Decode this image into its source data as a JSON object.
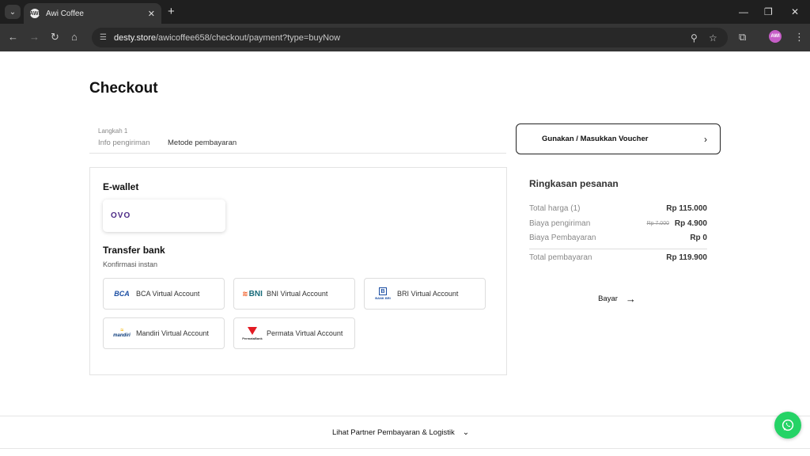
{
  "browser": {
    "tab_title": "Awi Coffee",
    "favicon_text": "AWI",
    "url_host": "desty.store",
    "url_path": "/awicoffee658/checkout/payment?type=buyNow",
    "profile_text": "AWI",
    "icons": [
      "search-tabs-icon",
      "close-icon",
      "plus-icon",
      "minimize-icon",
      "restore-icon",
      "close-window-icon",
      "back-icon",
      "forward-icon",
      "reload-icon",
      "home-icon",
      "site-info-icon",
      "zoom-icon",
      "star-icon",
      "extensions-icon",
      "menu-icon"
    ]
  },
  "page": {
    "title": "Checkout"
  },
  "steps": {
    "step_number": "Langkah 1",
    "step1_label": "Info pengiriman",
    "step2_label": "Metode pembayaran"
  },
  "voucher": {
    "label": "Gunakan / Masukkan Voucher"
  },
  "ewallet": {
    "title": "E-wallet",
    "items": [
      {
        "name": "ovo",
        "logo_text": "OVO"
      }
    ]
  },
  "bank": {
    "title": "Transfer bank",
    "subtitle": "Konfirmasi instan",
    "items": [
      {
        "label": "BCA Virtual Account",
        "logo_text": "BCA"
      },
      {
        "label": "BNI Virtual Account",
        "logo_text": "BNI"
      },
      {
        "label": "BRI Virtual Account",
        "logo_text": "BANK BRI"
      },
      {
        "label": "Mandiri Virtual Account",
        "logo_text": "mandiri"
      },
      {
        "label": "Permata Virtual Account",
        "logo_text": "PermataBank"
      }
    ]
  },
  "summary": {
    "title": "Ringkasan pesanan",
    "total_price_label": "Total harga (1)",
    "total_price_value": "Rp 115.000",
    "shipping_label": "Biaya pengiriman",
    "shipping_original": "Rp 7.000",
    "shipping_value": "Rp 4.900",
    "payment_fee_label": "Biaya Pembayaran",
    "payment_fee_value": "Rp 0",
    "grand_total_label": "Total pembayaran",
    "grand_total_value": "Rp 119.900"
  },
  "pay_button": {
    "label": "Bayar"
  },
  "footer": {
    "partner_link": "Lihat Partner Pembayaran & Logistik"
  },
  "colors": {
    "ovo": "#4c2a86",
    "whatsapp": "#25d366",
    "bca": "#1b4ea3"
  }
}
